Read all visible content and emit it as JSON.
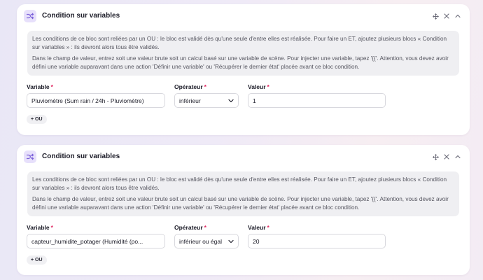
{
  "blocks": [
    {
      "title": "Condition sur variables",
      "info_p1": "Les conditions de ce bloc sont reliées par un OU : le bloc est validé dès qu'une seule d'entre elles est réalisée. Pour faire un ET, ajoutez plusieurs blocs « Condition sur variables » : ils devront alors tous être validés.",
      "info_p2": "Dans le champ de valeur, entrez soit une valeur brute soit un calcul basé sur une variable de scène. Pour injecter une variable, tapez '{{'. Attention, vous devez avoir défini une variable auparavant dans une action 'Définir une variable' ou 'Récupérer le dernier état' placée avant ce bloc condition.",
      "variable_label": "Variable",
      "variable_value": "Pluviomètre (Sum rain / 24h - Pluviomètre)",
      "operator_label": "Opérateur",
      "operator_value": "inférieur",
      "value_label": "Valeur",
      "value_value": "1",
      "required_mark": "*",
      "or_button": "+ OU"
    },
    {
      "title": "Condition sur variables",
      "info_p1": "Les conditions de ce bloc sont reliées par un OU : le bloc est validé dès qu'une seule d'entre elles est réalisée. Pour faire un ET, ajoutez plusieurs blocs « Condition sur variables » : ils devront alors tous être validés.",
      "info_p2": "Dans le champ de valeur, entrez soit une valeur brute soit un calcul basé sur une variable de scène. Pour injecter une variable, tapez '{{'. Attention, vous devez avoir défini une variable auparavant dans une action 'Définir une variable' ou 'Récupérer le dernier état' placée avant ce bloc condition.",
      "variable_label": "Variable",
      "variable_value": "capteur_humidite_potager (Humidité (po...",
      "operator_label": "Opérateur",
      "operator_value": "inférieur ou égal",
      "value_label": "Valeur",
      "value_value": "20",
      "required_mark": "*",
      "or_button": "+ OU"
    }
  ],
  "icons": {
    "block": "shuffle-icon",
    "move": "move-icon",
    "close": "close-icon",
    "collapse": "chevron-up-icon",
    "select": "chevron-down-icon"
  },
  "colors": {
    "accent": "#7b61d9",
    "icon_bg": "#e7e0fb",
    "required": "#e0245e"
  }
}
